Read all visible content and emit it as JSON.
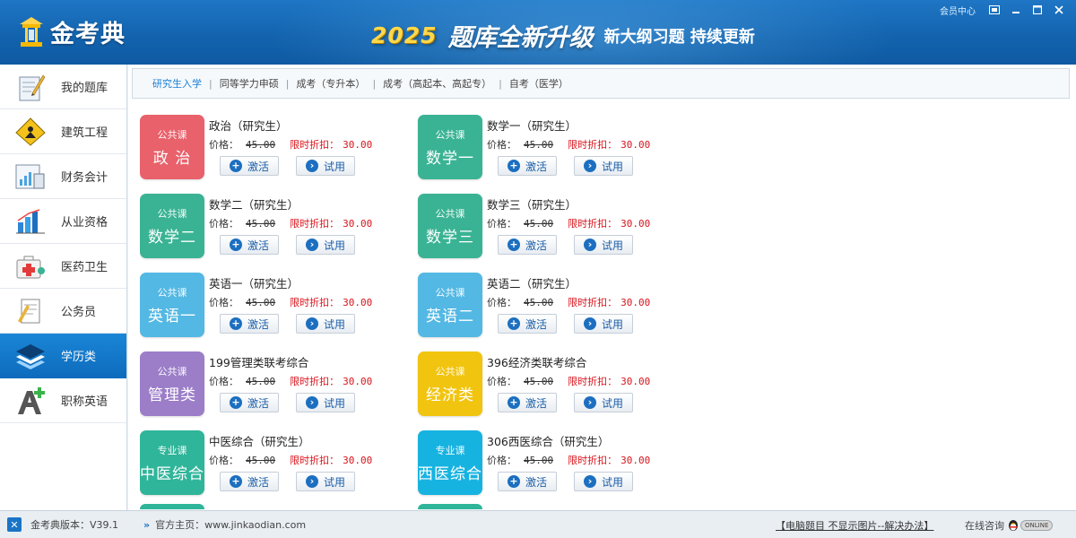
{
  "header": {
    "logo_text": "金考典",
    "banner_year": "2025",
    "banner_main": "题库全新升级",
    "banner_sub": "新大纲习题 持续更新",
    "member_center": "会员中心"
  },
  "sidebar": {
    "items": [
      {
        "label": "我的题库",
        "icon": "pen-notebook-icon",
        "active": false
      },
      {
        "label": "建筑工程",
        "icon": "construction-sign-icon",
        "active": false
      },
      {
        "label": "财务会计",
        "icon": "calculator-chart-icon",
        "active": false
      },
      {
        "label": "从业资格",
        "icon": "bar-chart-icon",
        "active": false
      },
      {
        "label": "医药卫生",
        "icon": "medical-kit-icon",
        "active": false
      },
      {
        "label": "公务员",
        "icon": "document-pen-icon",
        "active": false
      },
      {
        "label": "学历类",
        "icon": "layers-icon",
        "active": true
      },
      {
        "label": "职称英语",
        "icon": "letter-a-plus-icon",
        "active": false
      }
    ]
  },
  "tabs": [
    {
      "label": "研究生入学",
      "active": true
    },
    {
      "label": "同等学力申硕",
      "active": false
    },
    {
      "label": "成考（专升本）",
      "active": false
    },
    {
      "label": "成考（高起本、高起专）",
      "active": false
    },
    {
      "label": "自考（医学）",
      "active": false
    }
  ],
  "card_labels": {
    "price_label": "价格：",
    "discount_label": "限时折扣：",
    "activate": "激活",
    "trial": "试用"
  },
  "courses": [
    {
      "title": "政治（研究生）",
      "category": "公共课",
      "subject": "政 治",
      "color": "#e8616b",
      "price": "45.00",
      "discount": "30.00"
    },
    {
      "title": "数学一（研究生）",
      "category": "公共课",
      "subject": "数学一",
      "color": "#3ab394",
      "price": "45.00",
      "discount": "30.00"
    },
    {
      "title": "数学二（研究生）",
      "category": "公共课",
      "subject": "数学二",
      "color": "#3ab394",
      "price": "45.00",
      "discount": "30.00"
    },
    {
      "title": "数学三（研究生）",
      "category": "公共课",
      "subject": "数学三",
      "color": "#3ab394",
      "price": "45.00",
      "discount": "30.00"
    },
    {
      "title": "英语一（研究生）",
      "category": "公共课",
      "subject": "英语一",
      "color": "#53b8e3",
      "price": "45.00",
      "discount": "30.00"
    },
    {
      "title": "英语二（研究生）",
      "category": "公共课",
      "subject": "英语二",
      "color": "#53b8e3",
      "price": "45.00",
      "discount": "30.00"
    },
    {
      "title": "199管理类联考综合",
      "category": "公共课",
      "subject": "管理类",
      "color": "#9b7dc8",
      "price": "45.00",
      "discount": "30.00"
    },
    {
      "title": "396经济类联考综合",
      "category": "公共课",
      "subject": "经济类",
      "color": "#f1c40f",
      "price": "45.00",
      "discount": "30.00"
    },
    {
      "title": "中医综合（研究生）",
      "category": "专业课",
      "subject": "中医综合",
      "color": "#2fb59a",
      "price": "45.00",
      "discount": "30.00"
    },
    {
      "title": "306西医综合（研究生）",
      "category": "专业课",
      "subject": "西医综合",
      "color": "#17b3e0",
      "price": "45.00",
      "discount": "30.00"
    }
  ],
  "statusbar": {
    "version": "金考典版本：V39.1",
    "homepage": "官方主页：www.jinkaodian.com",
    "help_link": "【电脑题目 不显示图片--解决办法】",
    "consult": "在线咨询",
    "online": "ONLINE"
  },
  "colors": {
    "header_blue": "#1262ad",
    "active_blue": "#0e6bbd",
    "tab_active": "#1a7fd2",
    "discount_red": "#d8141c"
  }
}
